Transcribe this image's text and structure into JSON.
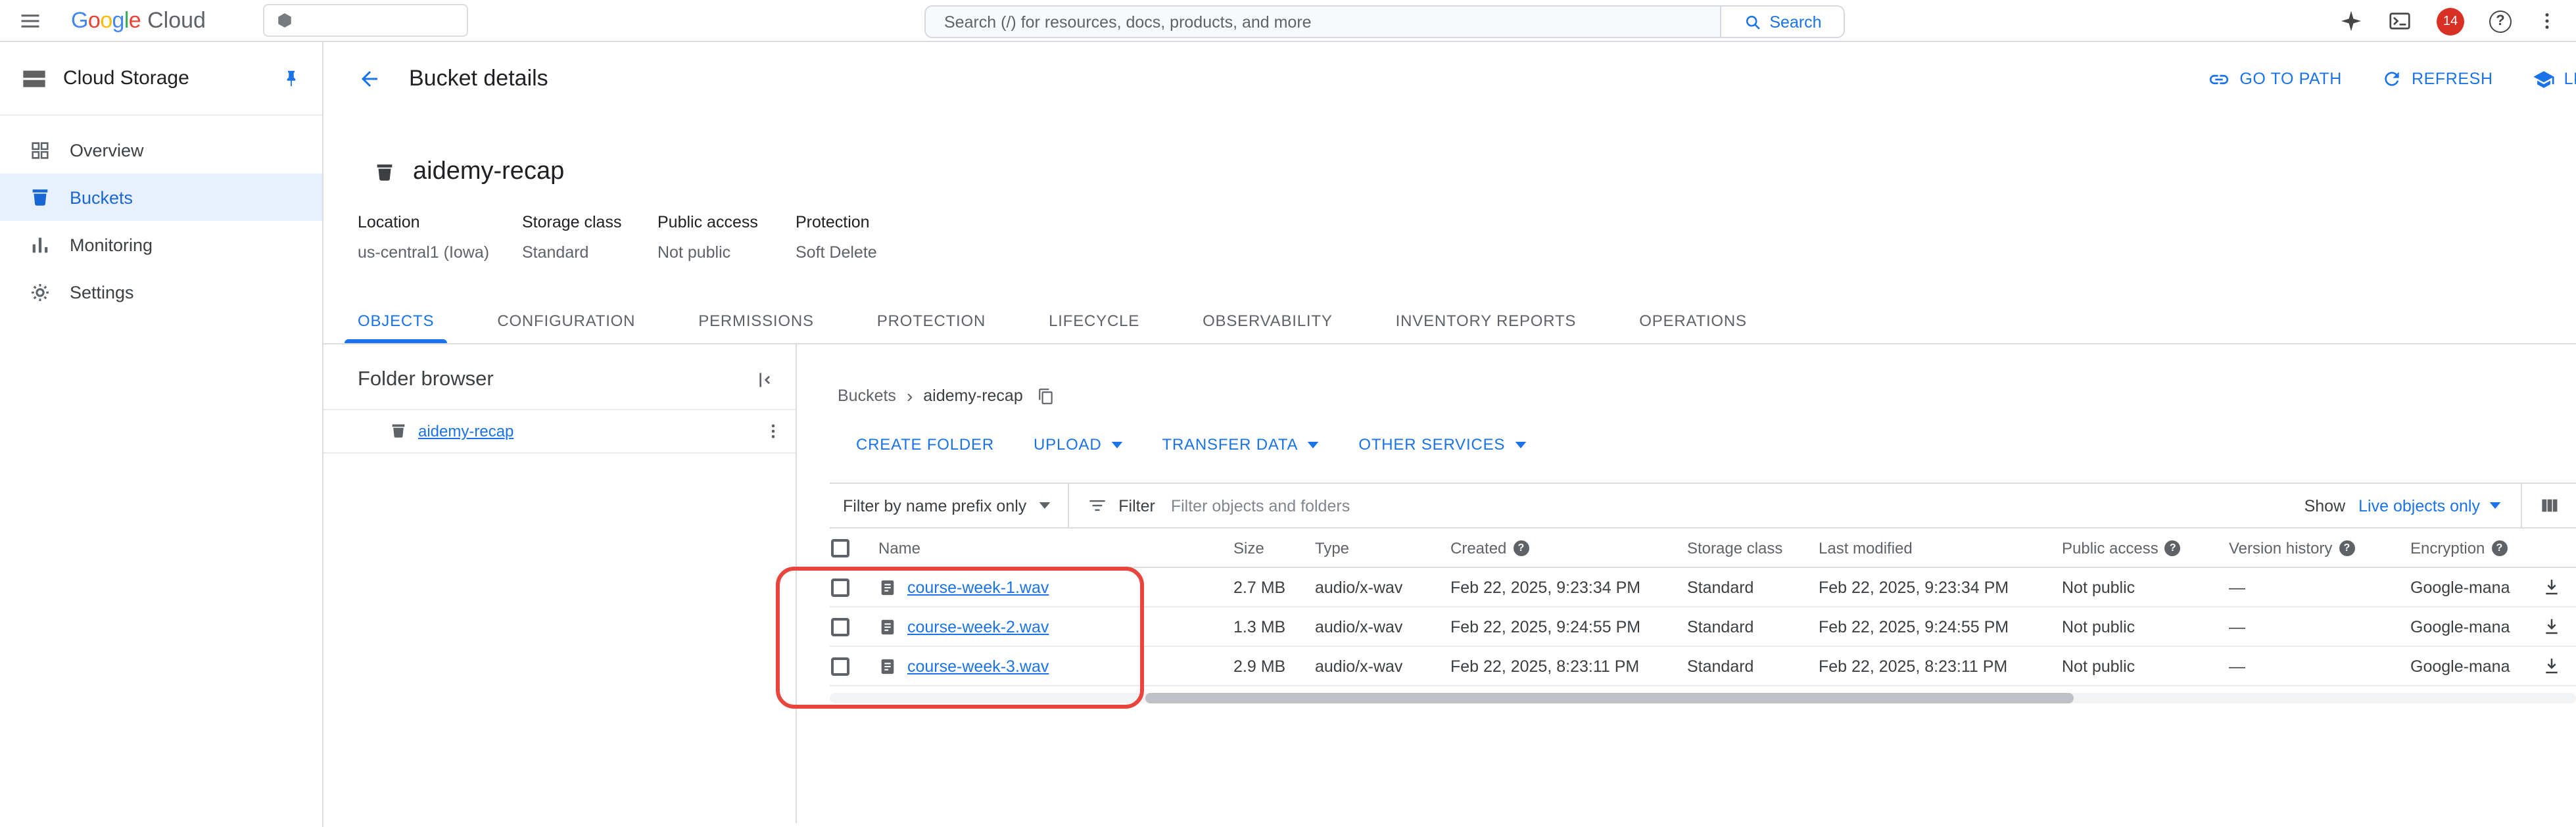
{
  "colors": {
    "accent_blue": "#1a73e8",
    "active_nav_bg": "#e8f0fe",
    "badge_red": "#d93025",
    "annotation_red": "#e8453c"
  },
  "topbar": {
    "logo_google": "Google",
    "logo_cloud": "Cloud",
    "search_placeholder": "Search (/) for resources, docs, products, and more",
    "search_button": "Search",
    "notification_count": "14"
  },
  "sidebar": {
    "product": "Cloud Storage",
    "items": [
      {
        "label": "Overview",
        "icon": "overview-icon",
        "active": false
      },
      {
        "label": "Buckets",
        "icon": "bucket-icon",
        "active": true
      },
      {
        "label": "Monitoring",
        "icon": "monitoring-icon",
        "active": false
      },
      {
        "label": "Settings",
        "icon": "settings-icon",
        "active": false
      }
    ]
  },
  "page_header": {
    "title": "Bucket details",
    "actions": [
      {
        "label": "GO TO PATH",
        "icon": "link-icon"
      },
      {
        "label": "REFRESH",
        "icon": "refresh-icon"
      },
      {
        "label": "LEARN",
        "icon": "school-icon"
      }
    ]
  },
  "bucket": {
    "name": "aidemy-recap",
    "meta": [
      {
        "label": "Location",
        "value": "us-central1 (Iowa)"
      },
      {
        "label": "Storage class",
        "value": "Standard"
      },
      {
        "label": "Public access",
        "value": "Not public"
      },
      {
        "label": "Protection",
        "value": "Soft Delete"
      }
    ]
  },
  "tabs": {
    "active": "OBJECTS",
    "items": [
      "OBJECTS",
      "CONFIGURATION",
      "PERMISSIONS",
      "PROTECTION",
      "LIFECYCLE",
      "OBSERVABILITY",
      "INVENTORY REPORTS",
      "OPERATIONS"
    ]
  },
  "folder_browser": {
    "title": "Folder browser",
    "items": [
      {
        "label": "aidemy-recap",
        "icon": "bucket-icon"
      }
    ]
  },
  "objects": {
    "breadcrumb": [
      "Buckets",
      "aidemy-recap"
    ],
    "actions": [
      {
        "label": "CREATE FOLDER",
        "caret": false
      },
      {
        "label": "UPLOAD",
        "caret": true
      },
      {
        "label": "TRANSFER DATA",
        "caret": true
      },
      {
        "label": "OTHER SERVICES",
        "caret": true
      }
    ],
    "filter_bar": {
      "prefix_filter": "Filter by name prefix only",
      "filter_label": "Filter",
      "filter_placeholder": "Filter objects and folders",
      "show_label": "Show",
      "show_value": "Live objects only"
    },
    "table": {
      "columns": [
        {
          "key": "name",
          "label": "Name",
          "help": false
        },
        {
          "key": "size",
          "label": "Size",
          "help": false
        },
        {
          "key": "type",
          "label": "Type",
          "help": false
        },
        {
          "key": "created",
          "label": "Created",
          "help": true
        },
        {
          "key": "storage_class",
          "label": "Storage class",
          "help": false
        },
        {
          "key": "last_modified",
          "label": "Last modified",
          "help": false
        },
        {
          "key": "public_access",
          "label": "Public access",
          "help": true
        },
        {
          "key": "version_history",
          "label": "Version history",
          "help": true
        },
        {
          "key": "encryption",
          "label": "Encryption",
          "help": true
        }
      ],
      "rows": [
        {
          "name": "course-week-1.wav",
          "size": "2.7 MB",
          "type": "audio/x-wav",
          "created": "Feb 22, 2025, 9:23:34 PM",
          "storage_class": "Standard",
          "last_modified": "Feb 22, 2025, 9:23:34 PM",
          "public_access": "Not public",
          "version_history": "—",
          "encryption": "Google-mana"
        },
        {
          "name": "course-week-2.wav",
          "size": "1.3 MB",
          "type": "audio/x-wav",
          "created": "Feb 22, 2025, 9:24:55 PM",
          "storage_class": "Standard",
          "last_modified": "Feb 22, 2025, 9:24:55 PM",
          "public_access": "Not public",
          "version_history": "—",
          "encryption": "Google-mana"
        },
        {
          "name": "course-week-3.wav",
          "size": "2.9 MB",
          "type": "audio/x-wav",
          "created": "Feb 22, 2025, 8:23:11 PM",
          "storage_class": "Standard",
          "last_modified": "Feb 22, 2025, 8:23:11 PM",
          "public_access": "Not public",
          "version_history": "—",
          "encryption": "Google-mana"
        }
      ]
    }
  }
}
